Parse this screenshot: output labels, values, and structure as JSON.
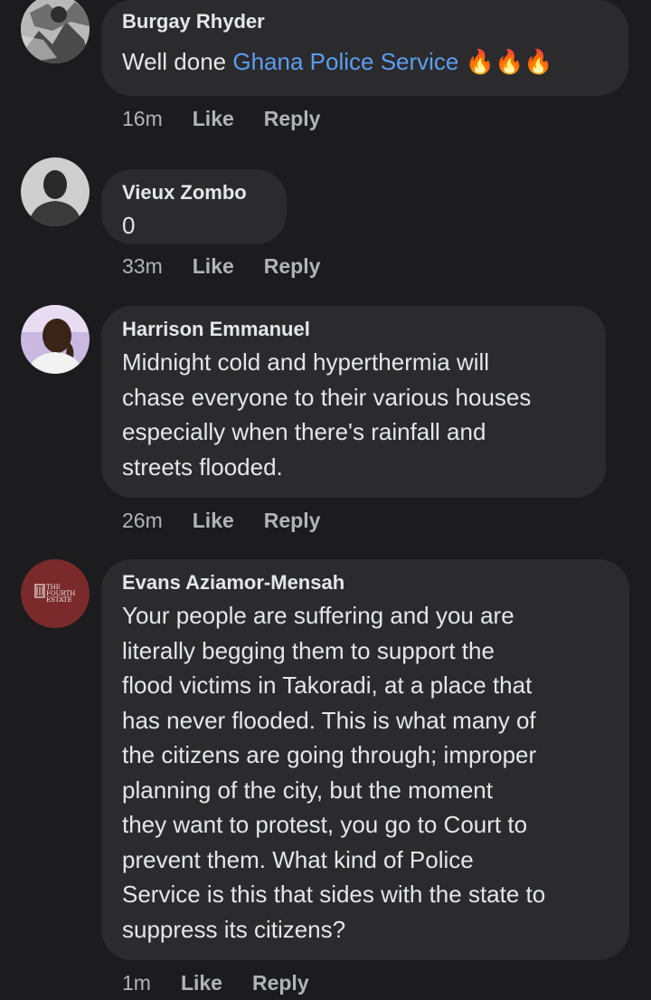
{
  "comments": [
    {
      "author": "Burgay Rhyder",
      "text_prefix": "Well done ",
      "tag": "Ghana Police Service",
      "emoji": "🔥🔥🔥",
      "time": "16m",
      "like": "Like",
      "reply": "Reply"
    },
    {
      "author": "Vieux Zombo",
      "text": "0",
      "time": "33m",
      "like": "Like",
      "reply": "Reply"
    },
    {
      "author": "Harrison Emmanuel",
      "text_lines": [
        "Midnight cold and hyperthermia will",
        "chase everyone to their various houses",
        "especially when there's rainfall and",
        "streets flooded."
      ],
      "time": "26m",
      "like": "Like",
      "reply": "Reply"
    },
    {
      "author": "Evans Aziamor-Mensah",
      "avatar_logo": [
        "THE",
        "FOURTH",
        "ESTATE"
      ],
      "text_lines": [
        "Your people are suffering and you are",
        "literally begging them to support the",
        "flood victims in Takoradi, at a place that",
        "has never flooded. This is what many of",
        "the citizens are going through; improper",
        "planning of the city, but the moment",
        "they want to protest, you go to Court to",
        "prevent them. What kind of Police",
        "Service is this that sides with the state to",
        "suppress its citizens?"
      ],
      "time": "1m",
      "like": "Like",
      "reply": "Reply"
    }
  ],
  "colors": {
    "background": "#1c1c1e",
    "bubble": "#2b2b2d",
    "link": "#5b9ef0",
    "meta": "#b0b3b8",
    "avatar_logo_bg": "#7a2a2a"
  }
}
